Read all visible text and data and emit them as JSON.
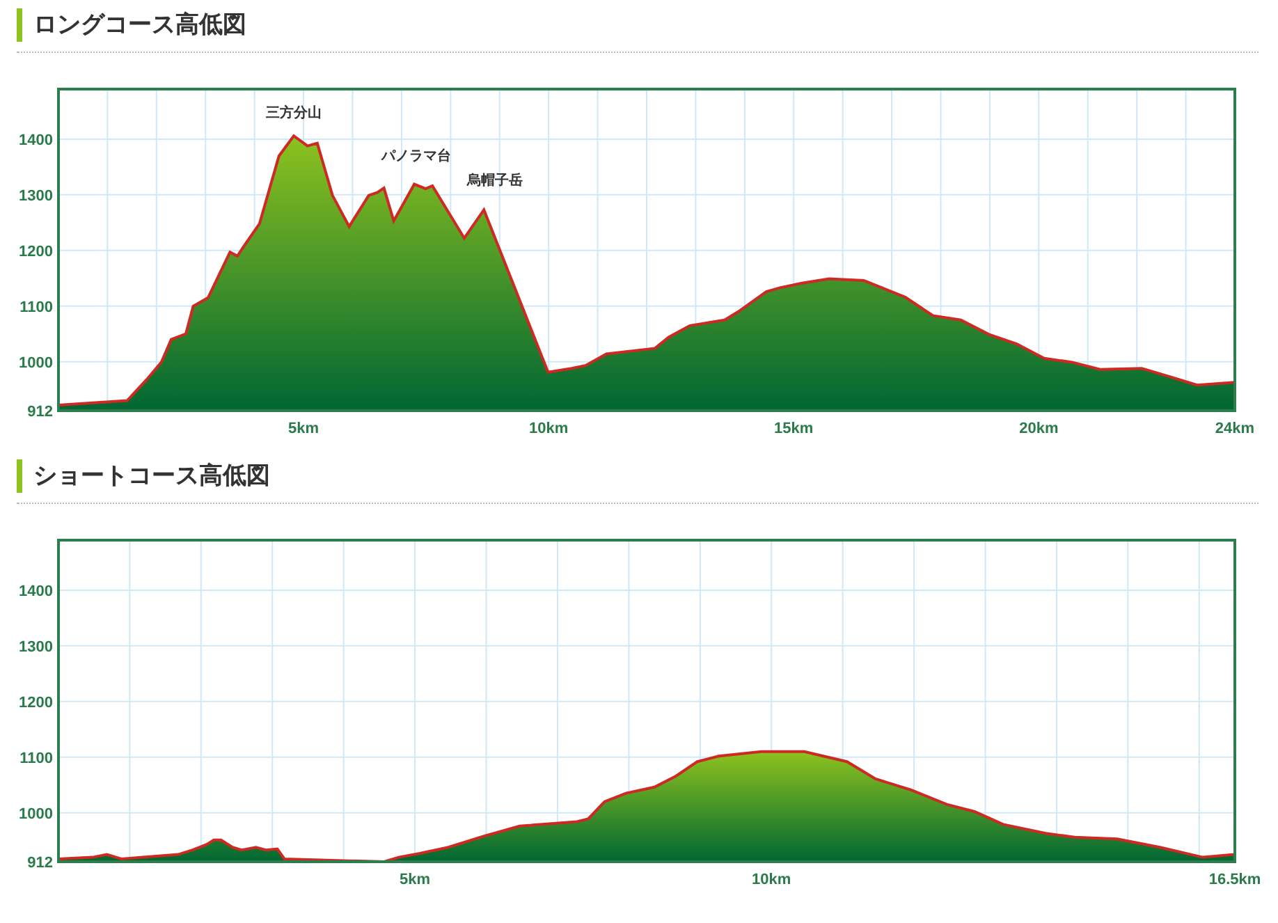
{
  "sections": [
    {
      "title": "ロングコース高低図",
      "chart_data": {
        "type": "area",
        "xlim": [
          0,
          24
        ],
        "ylim": [
          912,
          1490
        ],
        "yticks": [
          912,
          1000,
          1100,
          1200,
          1300,
          1400
        ],
        "xticks": [
          {
            "value": 5,
            "label": "5km"
          },
          {
            "value": 10,
            "label": "10km"
          },
          {
            "value": 15,
            "label": "15km"
          },
          {
            "value": 20,
            "label": "20km"
          },
          {
            "value": 24,
            "label": "24km"
          }
        ],
        "x": [
          0,
          1.4,
          1.8,
          2.1,
          2.3,
          2.6,
          2.75,
          3.05,
          3.5,
          3.65,
          3.8,
          4.1,
          4.5,
          4.8,
          5.08,
          5.28,
          5.59,
          5.93,
          6.33,
          6.5,
          6.64,
          6.84,
          7.26,
          7.49,
          7.63,
          8.28,
          8.68,
          9.99,
          10.47,
          10.75,
          11.18,
          12.17,
          12.45,
          12.88,
          13.59,
          13.87,
          14.44,
          14.72,
          15.15,
          15.72,
          16.43,
          17.28,
          17.84,
          18.41,
          18.98,
          19.55,
          20.11,
          20.68,
          21.25,
          22.1,
          22.67,
          23.23,
          24
        ],
        "series": [
          {
            "color": "#cc2a22",
            "values": [
              922,
              930,
              968,
              999,
              1040,
              1050,
              1100,
              1115,
              1197,
              1190,
              1210,
              1248,
              1370,
              1406,
              1388,
              1393,
              1299,
              1243,
              1299,
              1304,
              1312,
              1253,
              1319,
              1311,
              1316,
              1222,
              1273,
              981,
              988,
              993,
              1014,
              1024,
              1044,
              1065,
              1075,
              1090,
              1126,
              1133,
              1141,
              1149,
              1146,
              1116,
              1083,
              1075,
              1049,
              1032,
              1006,
              999,
              986,
              988,
              973,
              958,
              963
            ]
          }
        ],
        "grid": true,
        "annotations": [
          "三方分山",
          "パノラマ台",
          "烏帽子岳"
        ]
      }
    },
    {
      "title": "ショートコース高低図",
      "chart_data": {
        "type": "area",
        "xlim": [
          0,
          16.5
        ],
        "ylim": [
          912,
          1490
        ],
        "yticks": [
          912,
          1000,
          1100,
          1200,
          1300,
          1400
        ],
        "xticks": [
          {
            "value": 5,
            "label": "5km"
          },
          {
            "value": 10,
            "label": "10km"
          },
          {
            "value": 16.5,
            "label": "16.5km"
          }
        ],
        "x": [
          0,
          0.48,
          0.68,
          0.88,
          1.68,
          1.88,
          2.08,
          2.18,
          2.28,
          2.44,
          2.57,
          2.77,
          2.91,
          3.07,
          3.17,
          3.67,
          4.57,
          4.77,
          5.07,
          5.47,
          5.97,
          6.47,
          7.27,
          7.43,
          7.66,
          7.96,
          8.36,
          8.66,
          8.96,
          9.26,
          9.86,
          10.46,
          11.06,
          11.46,
          11.96,
          12.46,
          12.85,
          13.25,
          13.85,
          14.25,
          14.85,
          15.45,
          16.05,
          16.5
        ],
        "grid": true,
        "series": [
          {
            "color": "#cc2a22",
            "values": [
              917,
              920,
              925,
              917,
              925,
              933,
              943,
              951,
              951,
              938,
              933,
              938,
              933,
              935,
              917,
              915,
              912,
              920,
              927,
              938,
              958,
              976,
              984,
              989,
              1020,
              1035,
              1046,
              1066,
              1092,
              1102,
              1110,
              1110,
              1092,
              1061,
              1041,
              1015,
              1002,
              979,
              963,
              956,
              953,
              938,
              920,
              925
            ]
          }
        ]
      }
    }
  ]
}
